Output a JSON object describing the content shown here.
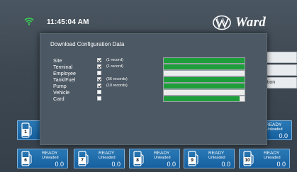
{
  "header": {
    "time": "11:45:04 AM",
    "brand": "Ward"
  },
  "side_menu": {
    "items": [
      "",
      "s",
      "ation"
    ]
  },
  "dialog": {
    "title": "Download Configuration Data",
    "rows": [
      {
        "label": "Site",
        "checked": true,
        "count": "(1 record)",
        "progress": 1.0
      },
      {
        "label": "Terminal",
        "checked": true,
        "count": "(1 record)",
        "progress": 1.0
      },
      {
        "label": "Employee",
        "checked": false,
        "count": "",
        "progress": 0.0
      },
      {
        "label": "Tank/Fuel",
        "checked": true,
        "count": "(56 records)",
        "progress": 1.0
      },
      {
        "label": "Pump",
        "checked": true,
        "count": "(10 records)",
        "progress": 1.0
      },
      {
        "label": "Vehicle",
        "checked": false,
        "count": "",
        "progress": 0.0
      },
      {
        "label": "Card",
        "checked": false,
        "count": "",
        "progress": 0.94
      }
    ]
  },
  "pumps": [
    {
      "number": "1",
      "status": "",
      "grade": "",
      "amount": ""
    },
    {
      "number": "",
      "status": "READY",
      "grade": "Unleaded",
      "amount": "0.0"
    },
    {
      "number": "6",
      "status": "READY",
      "grade": "Unleaded",
      "amount": "0.0"
    },
    {
      "number": "7",
      "status": "READY",
      "grade": "Unleaded",
      "amount": "0.0"
    },
    {
      "number": "8",
      "status": "READY",
      "grade": "Unleaded",
      "amount": "0.0"
    },
    {
      "number": "9",
      "status": "READY",
      "grade": "Unleaded",
      "amount": "0.0"
    },
    {
      "number": "10",
      "status": "READY",
      "grade": "Unleaded",
      "amount": "0.0"
    }
  ],
  "colors": {
    "progress_fill": "#1e9e3a",
    "pump_tile": "#1f6fae",
    "wifi": "#39d353"
  },
  "icons": {
    "wifi": "wifi-icon",
    "pump": "fuel-pump-icon",
    "logo": "ward-logo-icon"
  }
}
